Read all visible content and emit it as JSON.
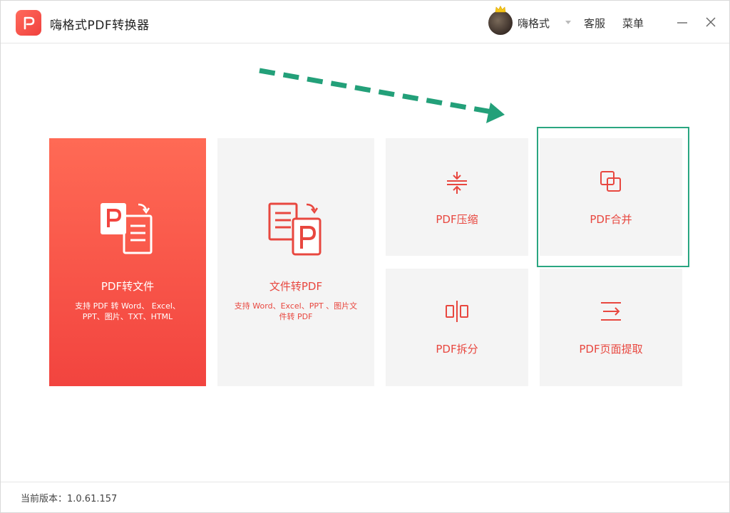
{
  "titlebar": {
    "app_title": "嗨格式PDF转换器",
    "username": "嗨格式",
    "service_label": "客服",
    "menu_label": "菜单"
  },
  "tiles": {
    "pdf_to_file": {
      "label": "PDF转文件",
      "desc_line1": "支持 PDF 转 Word、 Excel、",
      "desc_line2": "PPT、图片、TXT、HTML"
    },
    "file_to_pdf": {
      "label": "文件转PDF",
      "desc_line1": "支持 Word、Excel、PPT 、图片文",
      "desc_line2": "件转 PDF"
    },
    "compress": {
      "label": "PDF压缩"
    },
    "merge": {
      "label": "PDF合并"
    },
    "split": {
      "label": "PDF拆分"
    },
    "extract": {
      "label": "PDF页面提取"
    }
  },
  "footer": {
    "version_text": "当前版本：1.0.61.157"
  },
  "colors": {
    "accent_red": "#e8473f",
    "highlight_green": "#2aa681",
    "tile_bg": "#f4f4f4"
  }
}
